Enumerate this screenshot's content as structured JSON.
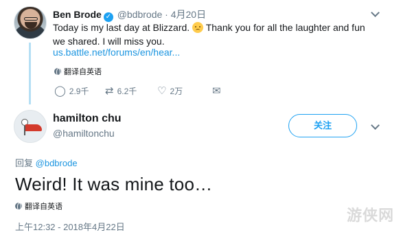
{
  "tweet": {
    "author_name": "Ben Brode",
    "handle": "@bdbrode",
    "separator": "·",
    "date": "4月20日",
    "text_before_emoji": "Today is my last day at Blizzard.",
    "text_after_emoji": "Thank you for all the laughter and fun we shared. I will miss you.",
    "link": "us.battle.net/forums/en/hear...",
    "translate_label": "翻译自英语",
    "replies_count": "2.9千",
    "retweets_count": "6.2千",
    "likes_count": "2万"
  },
  "reply": {
    "author_name": "hamilton chu",
    "handle": "@hamiltonchu",
    "follow_label": "关注",
    "reply_prefix": "回复",
    "reply_mention": "@bdbrode",
    "text": "Weird! It was mine too…",
    "translate_label": "翻译自英语",
    "timestamp": "上午12:32 - 2018年4月22日"
  },
  "icons": {
    "verified": "verified-badge-icon",
    "reply": "reply-icon",
    "retweet": "retweet-icon",
    "like": "heart-icon",
    "dm": "envelope-icon",
    "translate": "globe-icon",
    "more": "chevron-down-icon"
  },
  "colors": {
    "accent": "#1da1f2",
    "link": "#1b95e0",
    "muted": "#657786",
    "thread_line": "#b5dff4"
  },
  "watermark": "游侠网"
}
